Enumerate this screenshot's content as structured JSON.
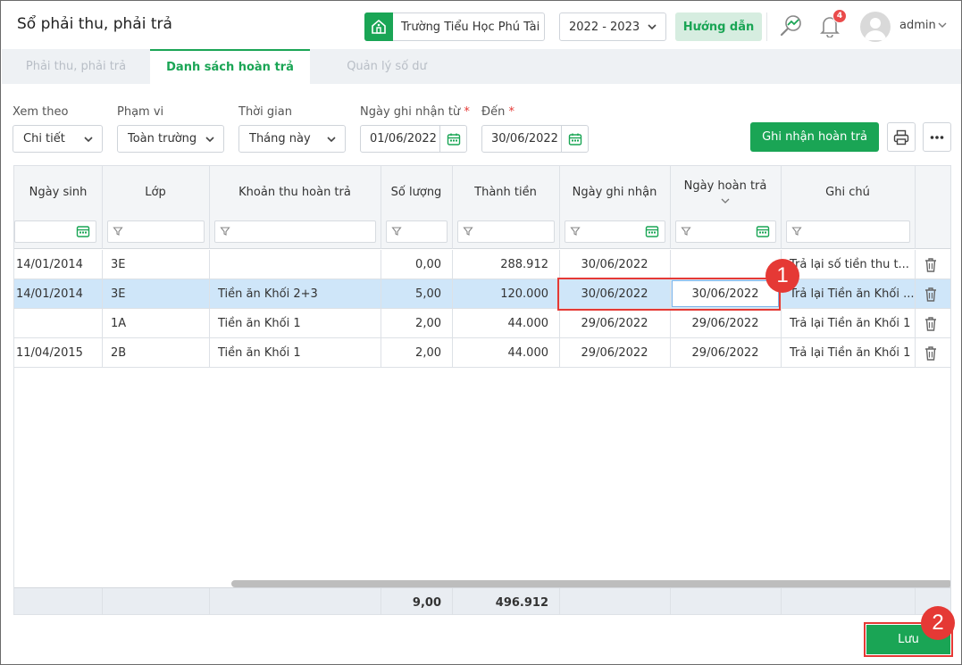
{
  "header": {
    "title": "Sổ phải thu, phải trả",
    "school": "Trường Tiểu Học Phú Tài",
    "year": "2022 - 2023",
    "guide_label": "Hướng dẫn",
    "notification_count": "4",
    "user": "admin"
  },
  "tabs": [
    {
      "label": "Phải thu, phải trả",
      "active": false
    },
    {
      "label": "Danh sách hoàn trả",
      "active": true
    },
    {
      "label": "Quản lý số dư",
      "active": false
    }
  ],
  "filters": {
    "view_label": "Xem theo",
    "view_value": "Chi tiết",
    "scope_label": "Phạm vi",
    "scope_value": "Toàn trường",
    "time_label": "Thời gian",
    "time_value": "Tháng này",
    "from_label": "Ngày ghi nhận từ",
    "from_value": "01/06/2022",
    "to_label": "Đến",
    "to_value": "30/06/2022",
    "required_mark": "*"
  },
  "actions": {
    "record_refund": "Ghi nhận hoàn trả",
    "save": "Lưu"
  },
  "table": {
    "columns": [
      "Ngày sinh",
      "Lớp",
      "Khoản thu hoàn trả",
      "Số lượng",
      "Thành tiền",
      "Ngày ghi nhận",
      "Ngày hoàn trả",
      "Ghi chú"
    ],
    "rows": [
      {
        "dob": "14/01/2014",
        "class": "3E",
        "item": "",
        "qty": "0,00",
        "amount": "288.912",
        "recorded": "30/06/2022",
        "refunded": "",
        "note": "Trả lại số tiền thu t..."
      },
      {
        "dob": "14/01/2014",
        "class": "3E",
        "item": "Tiền ăn Khối 2+3",
        "qty": "5,00",
        "amount": "120.000",
        "recorded": "30/06/2022",
        "refunded": "30/06/2022",
        "note": "Trả lại Tiền ăn Khối ..."
      },
      {
        "dob": "",
        "class": "1A",
        "item": "Tiền ăn Khối 1",
        "qty": "2,00",
        "amount": "44.000",
        "recorded": "29/06/2022",
        "refunded": "29/06/2022",
        "note": "Trả lại Tiền ăn Khối 1"
      },
      {
        "dob": "11/04/2015",
        "class": "2B",
        "item": "Tiền ăn Khối 1",
        "qty": "2,00",
        "amount": "44.000",
        "recorded": "29/06/2022",
        "refunded": "29/06/2022",
        "note": "Trả lại Tiền ăn Khối 1"
      }
    ],
    "totals": {
      "qty": "9,00",
      "amount": "496.912"
    }
  },
  "annotations": {
    "step1": "1",
    "step2": "2"
  },
  "colors": {
    "accent": "#1aa555",
    "highlight": "#e53935",
    "selected_row": "#cfe6f9"
  }
}
